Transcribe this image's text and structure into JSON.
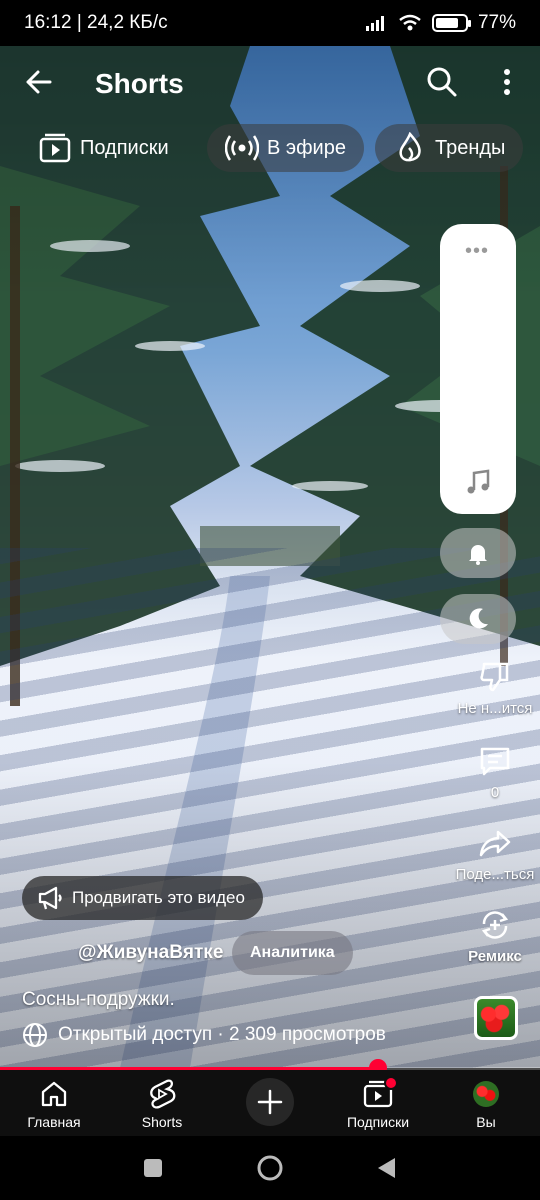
{
  "status_bar": {
    "time_speed": "16:12 | 24,2 КБ/с",
    "battery": "77%",
    "battery_level": 0.77
  },
  "header": {
    "title": "Shorts"
  },
  "chips": [
    {
      "label": "Подписки",
      "icon": "subscriptions-icon"
    },
    {
      "label": "В эфире",
      "icon": "live-icon"
    },
    {
      "label": "Тренды",
      "icon": "trending-icon"
    }
  ],
  "actions": {
    "dislike_label": "Не н...ится",
    "comments_count": "0",
    "share_label": "Поде...ться",
    "remix_label": "Ремикс"
  },
  "video": {
    "promote_label": "Продвигать это видео",
    "channel": "@ЖивунаВятке",
    "analytics_label": "Аналитика",
    "caption": "Сосны-подружки.",
    "access_views": "Открытый доступ · 2 309 просмотров",
    "progress": 0.7
  },
  "bottom_nav": {
    "home": "Главная",
    "shorts": "Shorts",
    "subscriptions": "Подписки",
    "you": "Вы"
  },
  "colors": {
    "accent": "#ff0033",
    "nav_bg": "#0f0f0f"
  }
}
